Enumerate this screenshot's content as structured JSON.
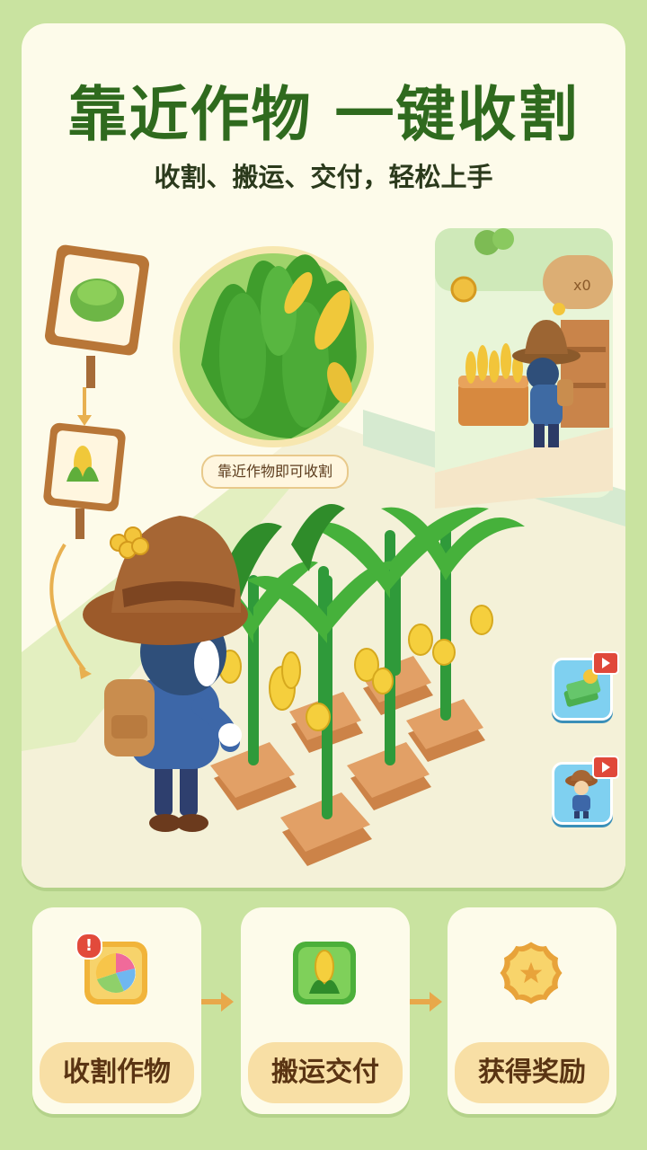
{
  "header": {
    "title": "靠近作物 一键收割",
    "subtitle": "收割、搬运、交付，轻松上手"
  },
  "scene": {
    "bubble_label": "靠近作物即可收割",
    "shop_counter_text": "x0",
    "side_buttons": [
      {
        "icon": "cash-reward-icon",
        "badge": "video-ad-icon"
      },
      {
        "icon": "farmer-character-icon",
        "badge": "video-ad-icon"
      }
    ]
  },
  "steps": [
    {
      "label": "收割作物",
      "icon": "color-wheel-icon",
      "alert": "!"
    },
    {
      "label": "搬运交付",
      "icon": "corn-icon"
    },
    {
      "label": "获得奖励",
      "icon": "star-coin-icon"
    }
  ],
  "colors": {
    "background": "#c9e3a0",
    "card": "#fdfbea",
    "title_green": "#2f6a1e",
    "pill": "#f8dfa5",
    "label_brown": "#5a3413"
  }
}
